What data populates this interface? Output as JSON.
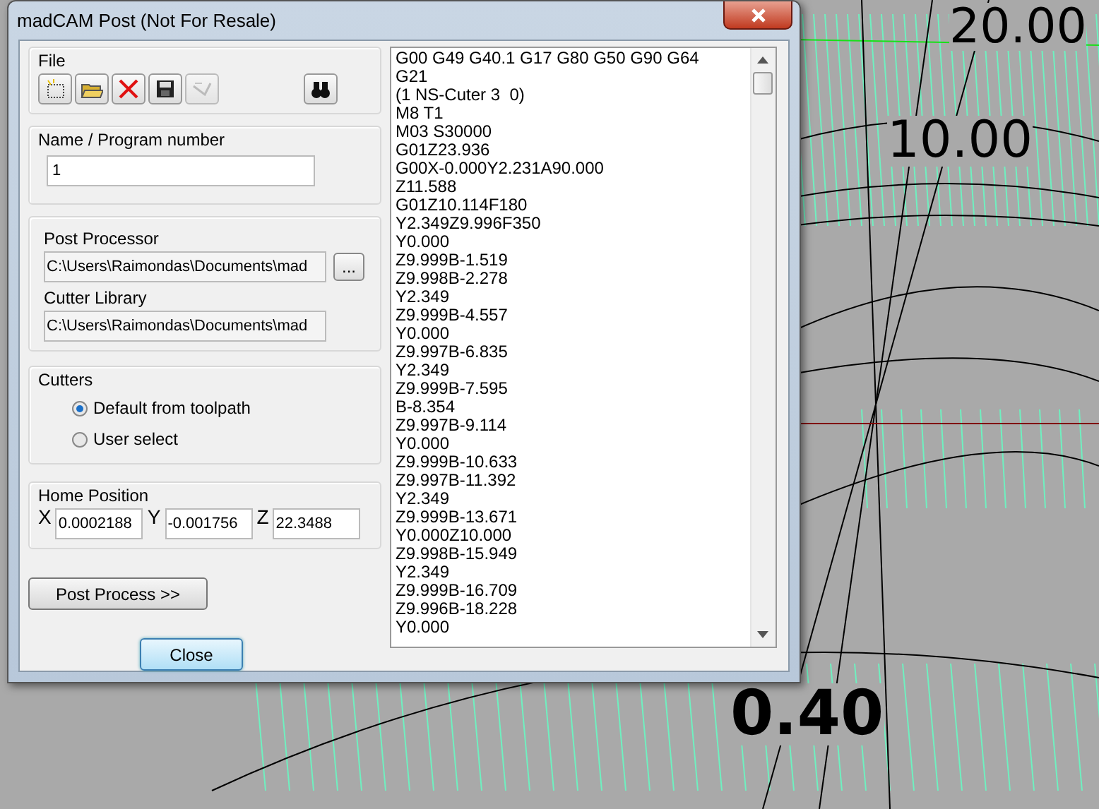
{
  "viewport": {
    "labels": [
      {
        "text": "20.00"
      },
      {
        "text": "10.00"
      },
      {
        "text": "0.40"
      }
    ]
  },
  "window": {
    "title": "madCAM Post (Not For Resale)"
  },
  "file_group": {
    "label": "File",
    "tools": [
      {
        "kind": "new",
        "disabled": false
      },
      {
        "kind": "open",
        "disabled": false
      },
      {
        "kind": "delete",
        "disabled": false
      },
      {
        "kind": "save",
        "disabled": false
      },
      {
        "kind": "wizard",
        "disabled": true
      }
    ],
    "find": {
      "kind": "find",
      "disabled": false
    }
  },
  "name_group": {
    "label": "Name / Program number",
    "value": "1"
  },
  "post_group": {
    "post_processor_label": "Post Processor",
    "post_processor_value": "C:\\Users\\Raimondas\\Documents\\mad",
    "browse": "...",
    "cutter_library_label": "Cutter Library",
    "cutter_library_value": "C:\\Users\\Raimondas\\Documents\\mad"
  },
  "cutters": {
    "label": "Cutters",
    "options": [
      {
        "label": "Default from toolpath",
        "selected": true
      },
      {
        "label": "User select",
        "selected": false
      }
    ]
  },
  "home": {
    "label": "Home Position",
    "fields": [
      {
        "axis": "X",
        "value": "0.0002188"
      },
      {
        "axis": "Y",
        "value": "-0.001756"
      },
      {
        "axis": "Z",
        "value": "22.3488"
      }
    ]
  },
  "buttons": [
    {
      "label": "Post Process >>",
      "default": false
    },
    {
      "label": "Close",
      "default": true
    }
  ],
  "output": {
    "lines": [
      "G00 G49 G40.1 G17 G80 G50 G90 G64",
      "G21",
      "(1 NS-Cuter 3  0)",
      "M8 T1",
      "M03 S30000",
      "G01Z23.936",
      "G00X-0.000Y2.231A90.000",
      "Z11.588",
      "G01Z10.114F180",
      "Y2.349Z9.996F350",
      "Y0.000",
      "Z9.999B-1.519",
      "Z9.998B-2.278",
      "Y2.349",
      "Z9.999B-4.557",
      "Y0.000",
      "Z9.997B-6.835",
      "Y2.349",
      "Z9.999B-7.595",
      "B-8.354",
      "Z9.997B-9.114",
      "Y0.000",
      "Z9.999B-10.633",
      "Z9.997B-11.392",
      "Y2.349",
      "Z9.999B-13.671",
      "Y0.000Z10.000",
      "Z9.998B-15.949",
      "Y2.349",
      "Z9.999B-16.709",
      "Z9.996B-18.228",
      "Y0.000"
    ]
  }
}
